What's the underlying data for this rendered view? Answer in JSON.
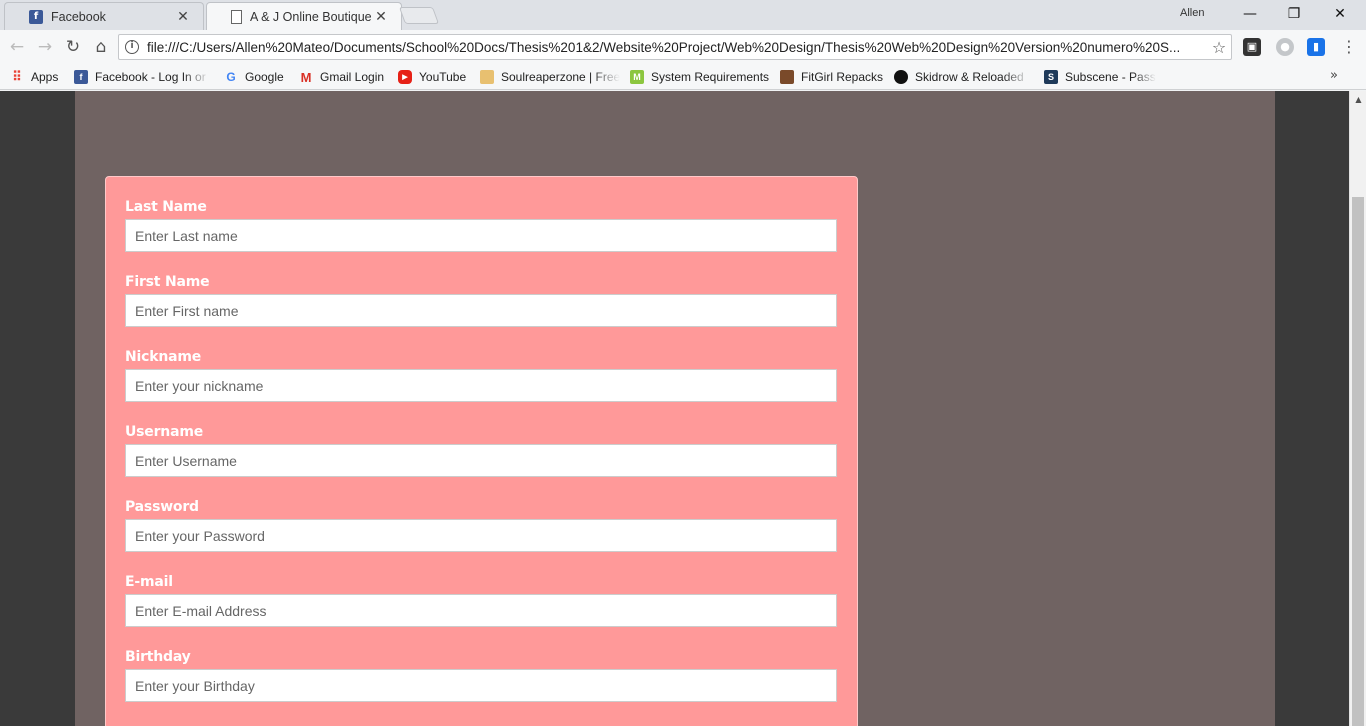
{
  "tabs": [
    {
      "title": "Facebook",
      "favicon": "facebook-icon"
    },
    {
      "title": "A & J Online Boutique",
      "favicon": "document-icon",
      "active": true
    }
  ],
  "window": {
    "profile_name": "Allen"
  },
  "toolbar": {
    "url": "file:///C:/Users/Allen%20Mateo/Documents/School%20Docs/Thesis%201&2/Website%20Project/Web%20Design/Thesis%20Web%20Design%20Version%20numero%20S..."
  },
  "bookmarks": {
    "apps": "Apps",
    "facebook": "Facebook - Log In or",
    "google": "Google",
    "gmail": "Gmail Login",
    "youtube": "YouTube",
    "soulreaperzone": "Soulreaperzone | Free",
    "system_requirements": "System Requirements",
    "fitgirl": "FitGirl Repacks",
    "skidrow": "Skidrow & Reloaded",
    "subscene": "Subscene - Passionate"
  },
  "form": {
    "fields": [
      {
        "label": "Last Name",
        "placeholder": "Enter Last name"
      },
      {
        "label": "First Name",
        "placeholder": "Enter First name"
      },
      {
        "label": "Nickname",
        "placeholder": "Enter your nickname"
      },
      {
        "label": "Username",
        "placeholder": "Enter Username"
      },
      {
        "label": "Password",
        "placeholder": "Enter your Password"
      },
      {
        "label": "E-mail",
        "placeholder": "Enter E-mail Address"
      },
      {
        "label": "Birthday",
        "placeholder": "Enter your Birthday"
      }
    ]
  },
  "colors": {
    "page_background": "#3a3a3a",
    "content_background": "#706362",
    "form_background": "#ff9999",
    "label_text": "#ffffff"
  }
}
